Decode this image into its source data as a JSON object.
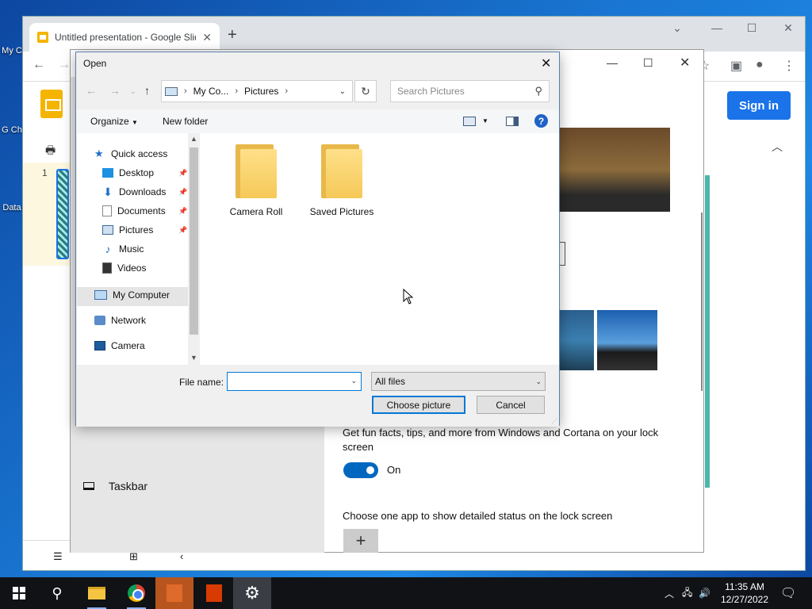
{
  "desktop": {
    "icons": [
      {
        "label": "My C"
      },
      {
        "label": "G Ch"
      },
      {
        "label": "Data"
      }
    ]
  },
  "chrome": {
    "tab_title": "Untitled presentation - Google Slides",
    "sign_in": "Sign in"
  },
  "slides": {
    "slide_number": "1"
  },
  "settings": {
    "nav_taskbar": "Taskbar",
    "lock_facts": "Get fun facts, tips, and more from Windows and Cortana on your lock screen",
    "toggle_state": "On",
    "app_status": "Choose one app to show detailed status on the lock screen"
  },
  "dialog": {
    "title": "Open",
    "breadcrumb": [
      "My Co...",
      "Pictures"
    ],
    "search_placeholder": "Search Pictures",
    "organize": "Organize",
    "new_folder": "New folder",
    "nav_items": [
      {
        "label": "Quick access",
        "icon": "star-icon"
      },
      {
        "label": "Desktop",
        "icon": "desktop-icon",
        "pinned": true
      },
      {
        "label": "Downloads",
        "icon": "download-icon",
        "pinned": true
      },
      {
        "label": "Documents",
        "icon": "documents-icon",
        "pinned": true
      },
      {
        "label": "Pictures",
        "icon": "pictures-icon",
        "pinned": true
      },
      {
        "label": "Music",
        "icon": "music-icon"
      },
      {
        "label": "Videos",
        "icon": "videos-icon"
      },
      {
        "label": "My Computer",
        "icon": "computer-icon",
        "selected": true
      },
      {
        "label": "Network",
        "icon": "network-icon"
      },
      {
        "label": "Camera",
        "icon": "camera-icon"
      }
    ],
    "folders": [
      {
        "label": "Camera Roll"
      },
      {
        "label": "Saved Pictures"
      }
    ],
    "file_name_label": "File name:",
    "file_name_value": "",
    "file_type": "All files",
    "choose_button": "Choose picture",
    "cancel_button": "Cancel"
  },
  "taskbar": {
    "time": "11:35 AM",
    "date": "12/27/2022"
  }
}
